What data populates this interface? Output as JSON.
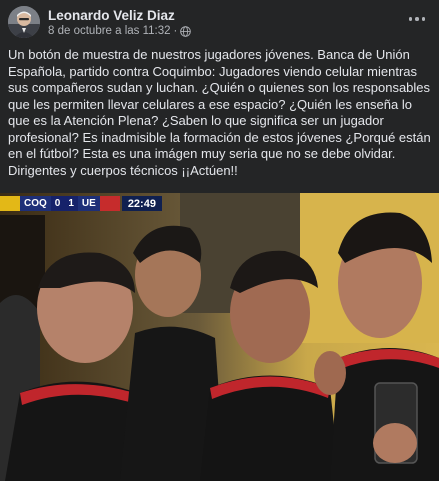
{
  "post": {
    "author": "Leonardo Veliz Diaz",
    "timestamp": "8 de octubre a las 11:32",
    "separator": "·",
    "privacy_icon": "globe-icon",
    "menu_icon": "more-options-icon",
    "text": "Un botón de muestra de nuestros jugadores jóvenes. Banca de Unión Española, partido contra Coquimbo: Jugadores viendo celular mientras sus compañeros sudan y luchan. ¿Quién o quienes son los responsables que les permiten llevar celulares a ese espacio? ¿Quién les enseña lo que es la Atención Plena? ¿Saben lo que significa ser un jugador profesional? Es inadmisible la formación de estos jóvenes ¿Porqué están en el fútbol? Esta es una imágen muy seria que no se debe olvidar. Dirigentes y cuerpos técnicos ¡¡Actúen!!"
  },
  "photo": {
    "scorebug": {
      "home_team": "COQ",
      "home_score": "0",
      "away_score": "1",
      "away_team": "UE",
      "clock": "22:49"
    }
  },
  "colors": {
    "background": "#242526",
    "text_primary": "#e4e6eb",
    "text_secondary": "#b0b3b8",
    "scorebug_blue": "#1e2f78",
    "jersey_black": "#151515",
    "jersey_red": "#c0262c"
  }
}
